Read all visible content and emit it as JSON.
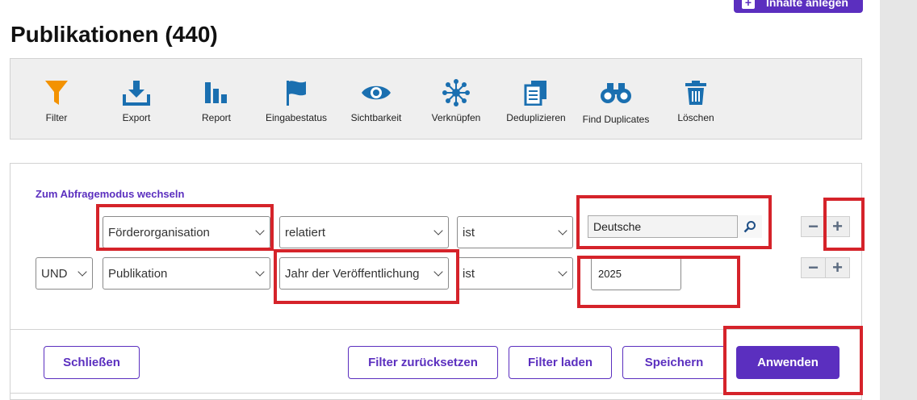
{
  "header": {
    "create_label": "Inhalte anlegen",
    "title": "Publikationen (440)"
  },
  "toolbar": {
    "items": [
      {
        "label": "Filter",
        "icon": "filter-icon"
      },
      {
        "label": "Export",
        "icon": "export-icon"
      },
      {
        "label": "Report",
        "icon": "report-icon"
      },
      {
        "label": "Eingabestatus",
        "icon": "flag-icon"
      },
      {
        "label": "Sichtbarkeit",
        "icon": "eye-icon"
      },
      {
        "label": "Verknüpfen",
        "icon": "link-network-icon"
      },
      {
        "label": "Deduplizieren",
        "icon": "copy-icon"
      },
      {
        "label": "Find Duplicates",
        "icon": "binoculars-icon"
      },
      {
        "label": "Löschen",
        "icon": "trash-icon"
      }
    ]
  },
  "filter": {
    "mode_link": "Zum Abfragemodus wechseln",
    "rows": [
      {
        "field": "Förderorganisation",
        "relation": "relatiert",
        "operator": "ist",
        "value": "Deutsche"
      },
      {
        "conjunction": "UND",
        "field": "Publikation",
        "relation": "Jahr der Veröffentlichung",
        "operator": "ist",
        "value": "2025"
      }
    ]
  },
  "actions": {
    "close": "Schließen",
    "reset": "Filter zurücksetzen",
    "load": "Filter laden",
    "save": "Speichern",
    "apply": "Anwenden"
  },
  "colors": {
    "brand": "#5b2fbf",
    "filter_icon": "#f39200",
    "icon_blue": "#1a6fb0",
    "highlight": "#d5232a"
  }
}
